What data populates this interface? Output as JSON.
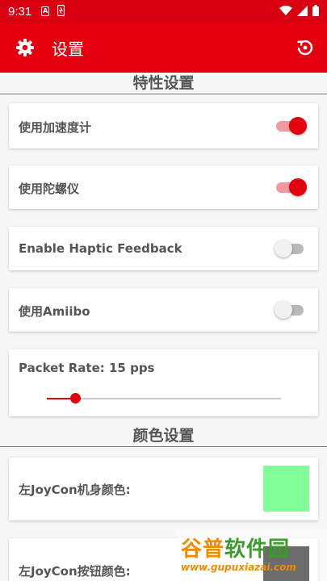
{
  "status_bar": {
    "time": "9:31",
    "icon_a": "A"
  },
  "app_bar": {
    "title": "设置"
  },
  "sections": {
    "features": "特性设置",
    "colors": "颜色设置"
  },
  "settings": {
    "accelerometer": {
      "label": "使用加速度计",
      "enabled": true
    },
    "gyroscope": {
      "label": "使用陀螺仪",
      "enabled": true
    },
    "haptic": {
      "label": "Enable Haptic Feedback",
      "enabled": false
    },
    "amiibo": {
      "label": "使用Amiibo",
      "enabled": false
    },
    "packet_rate": {
      "label": "Packet Rate: 15 pps",
      "value": 15,
      "level": 0.12
    }
  },
  "colors": {
    "left_body": {
      "label": "左JoyCon机身颜色:",
      "color": "#82ff99"
    },
    "left_buttons": {
      "label": "左JoyCon按钮颜色:",
      "color": "#1e1e1e"
    }
  },
  "watermark": {
    "text_left": "谷普",
    "text_right": "软件园",
    "url": "www.gupuxiazai.com"
  },
  "theme": {
    "primary": "#e5000f",
    "accent": "#e3000e"
  }
}
